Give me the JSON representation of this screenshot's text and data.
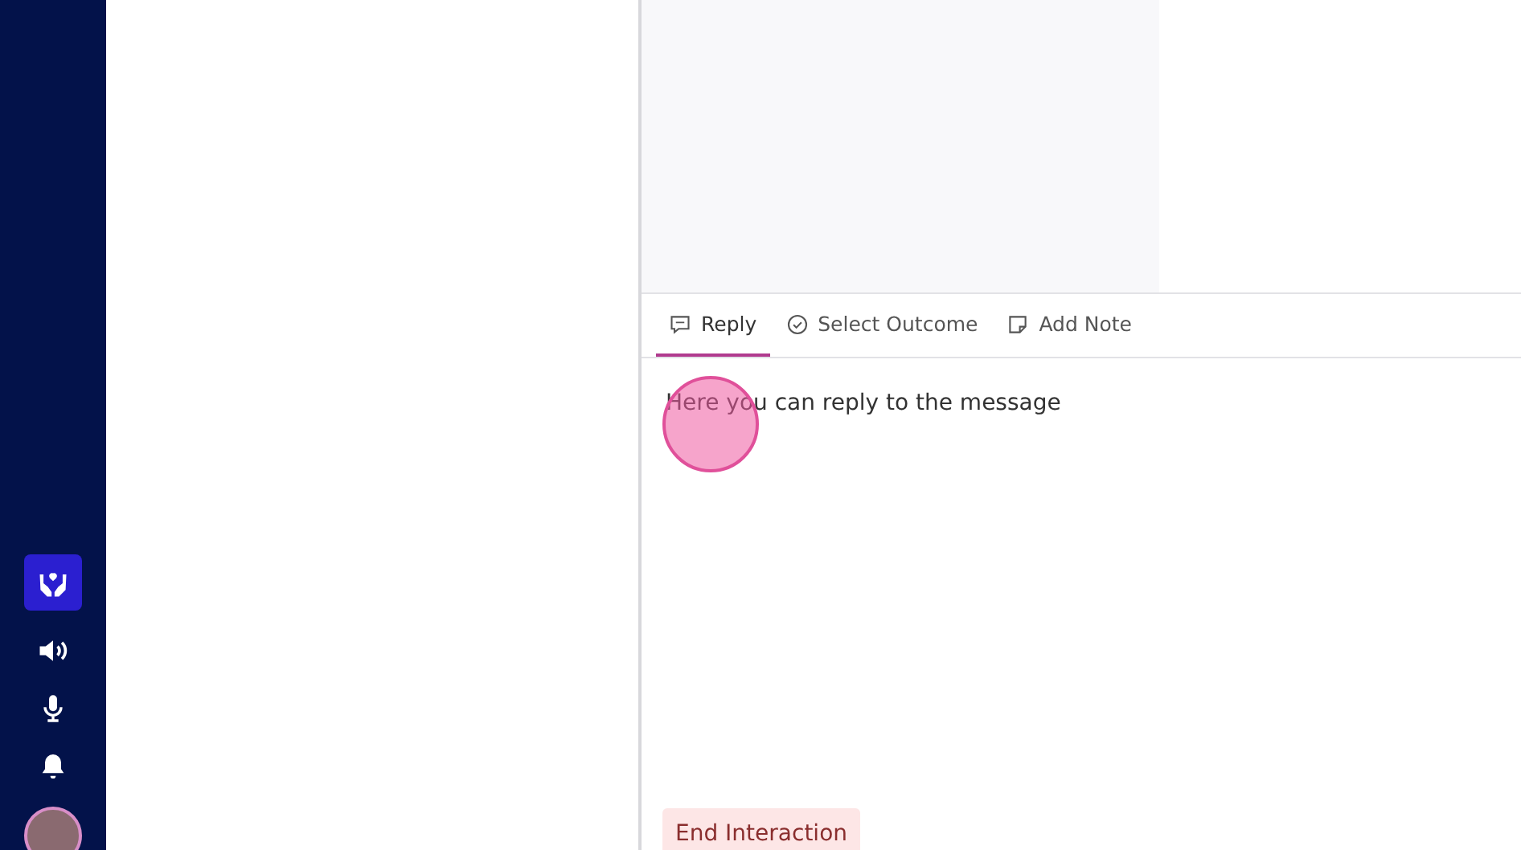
{
  "sidebar": {
    "items": [
      {
        "kind": "app",
        "selected": true
      },
      {
        "kind": "speaker",
        "selected": false
      },
      {
        "kind": "microphone",
        "selected": false
      },
      {
        "kind": "bell",
        "selected": false
      },
      {
        "kind": "avatar",
        "selected": false
      }
    ]
  },
  "tabs": [
    {
      "kind": "reply",
      "label": "Reply",
      "selected": true
    },
    {
      "kind": "outcome",
      "label": "Select Outcome",
      "selected": false
    },
    {
      "kind": "note",
      "label": "Add Note",
      "selected": false
    }
  ],
  "reply": {
    "placeholder": "Here you can reply to the message"
  },
  "click_marker": true,
  "buttons": [
    {
      "label": "End Interaction"
    }
  ]
}
